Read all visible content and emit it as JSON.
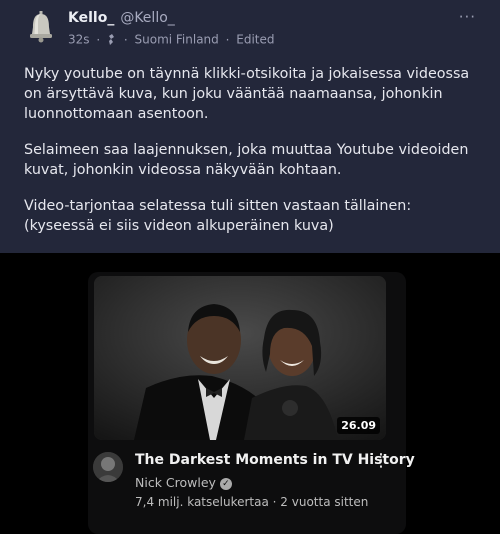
{
  "post": {
    "display_name": "Kello_",
    "handle": "@Kello_",
    "time_ago": "32s",
    "separator": "·",
    "location": "Suomi Finland",
    "edited": "Edited",
    "menu": "···",
    "paragraphs": [
      "Nyky youtube on täynnä klikki-otsikoita ja jokaisessa videossa on ärsyttävä kuva, kun joku vääntää naamaansa, johonkin luonnottomaan asentoon.",
      "Selaimeen saa laajennuksen, joka muuttaa Youtube videoiden kuvat, johonkin videossa näkyvään kohtaan.",
      "Video-tarjontaa selatessa tuli sitten vastaan tällainen:",
      "(kyseessä ei siis videon alkuperäinen kuva)"
    ]
  },
  "video": {
    "duration": "26.09",
    "title": "The Darkest Moments in TV History",
    "channel": "Nick Crowley",
    "verified_mark": "✓",
    "stats": "7,4 milj. katselukertaa · 2 vuotta sitten",
    "menu": "⋮"
  }
}
